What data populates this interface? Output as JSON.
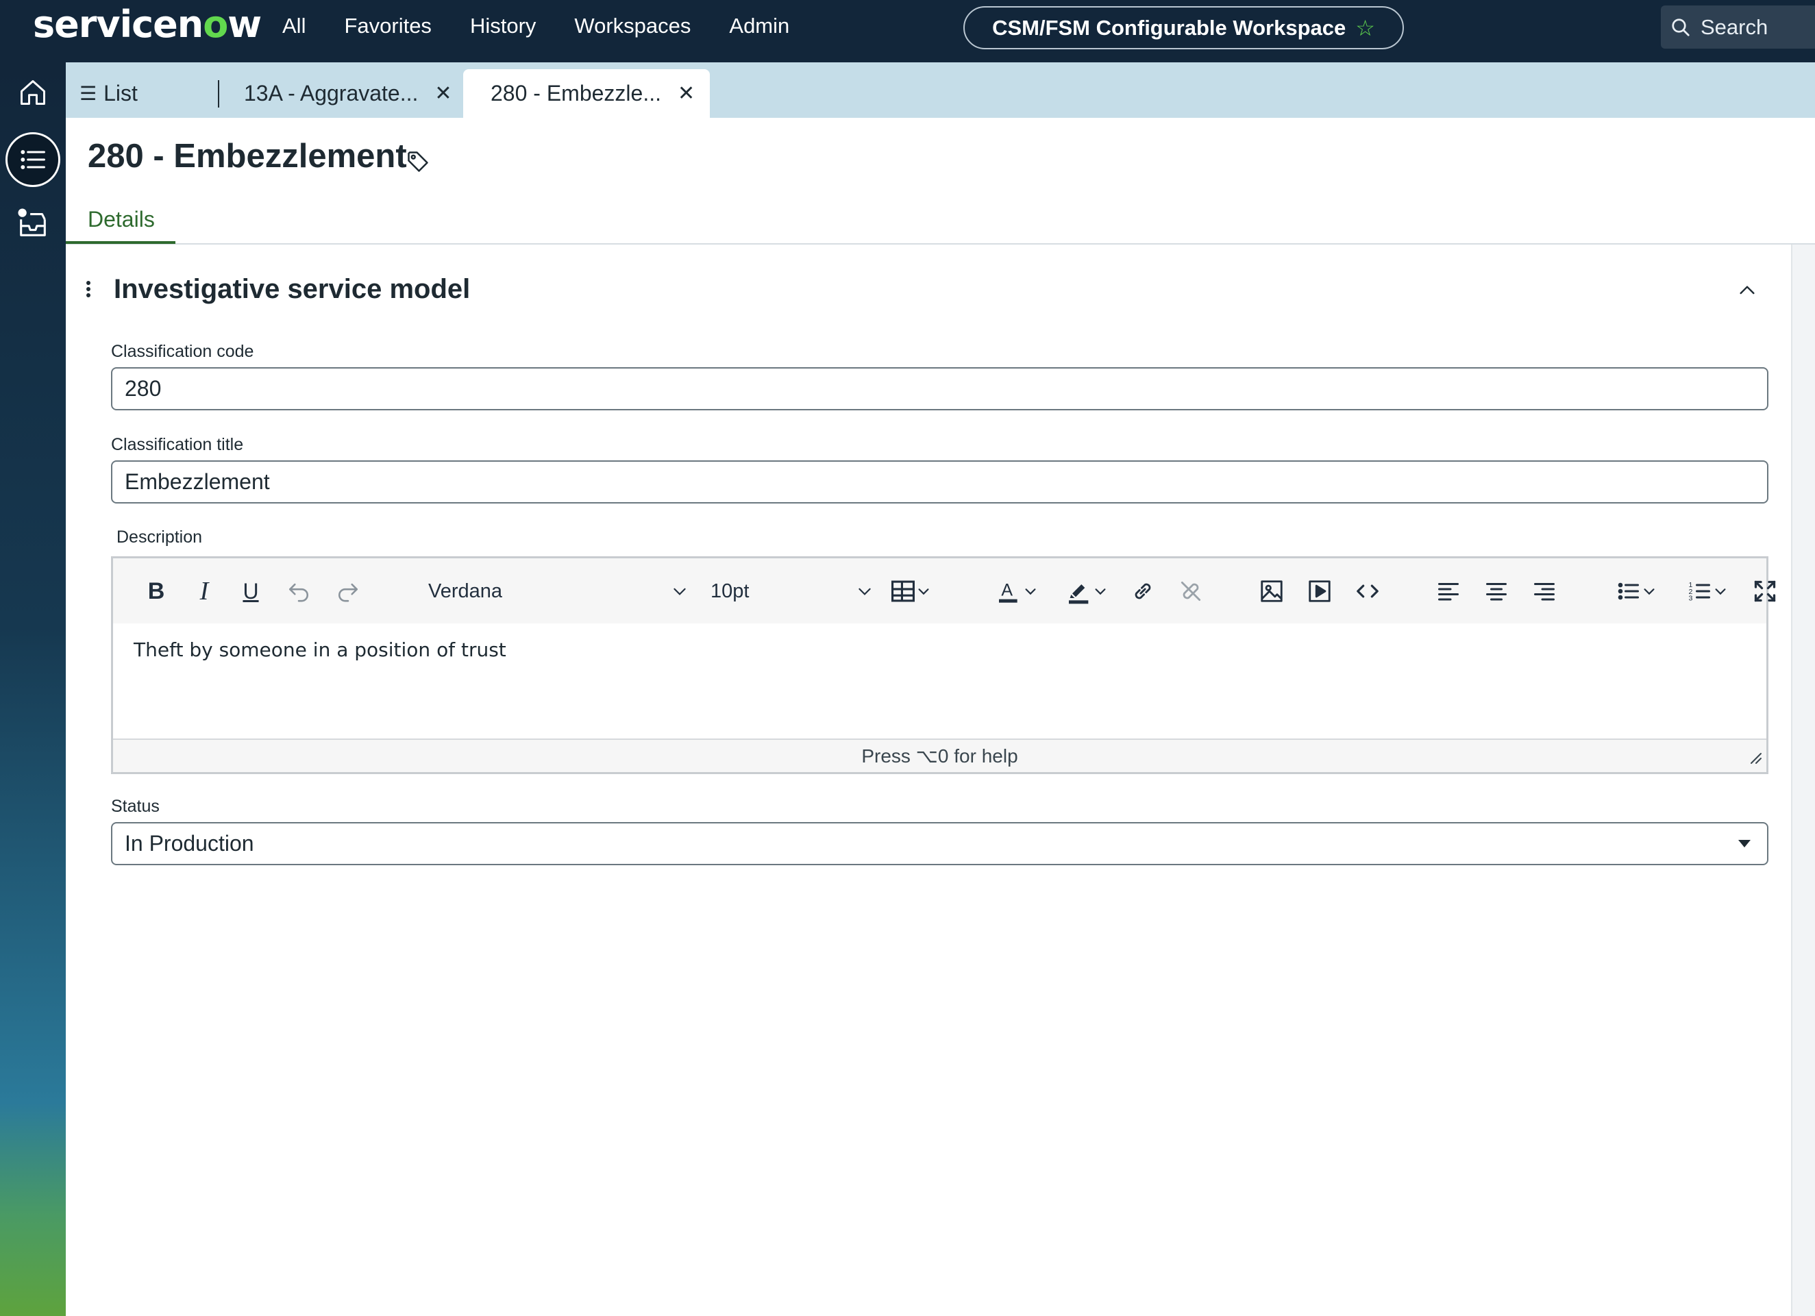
{
  "topnav": {
    "logo_text_pre": "servicen",
    "logo_text_accent": "o",
    "logo_text_post": "w",
    "items": [
      "All",
      "Favorites",
      "History",
      "Workspaces",
      "Admin"
    ],
    "workspace_label": "CSM/FSM Configurable Workspace",
    "search_label": "Search"
  },
  "rail": {
    "icons": [
      "home-icon",
      "list-icon",
      "inbox-icon"
    ]
  },
  "tabs": {
    "list_label": "List",
    "items": [
      {
        "label": "13A - Aggravate...",
        "active": false
      },
      {
        "label": "280 - Embezzle...",
        "active": true
      }
    ]
  },
  "record": {
    "title": "280 - Embezzlement",
    "subtabs": [
      "Details"
    ]
  },
  "section": {
    "title": "Investigative service model",
    "fields": {
      "classification_code": {
        "label": "Classification code",
        "value": "280"
      },
      "classification_title": {
        "label": "Classification title",
        "value": "Embezzlement"
      },
      "description": {
        "label": "Description",
        "font_family": "Verdana",
        "font_size": "10pt",
        "content": "Theft by someone in a position of trust",
        "status_hint": "Press ⌥0 for help"
      },
      "status": {
        "label": "Status",
        "value": "In Production"
      }
    }
  },
  "colors": {
    "nav_bg": "#12263a",
    "tab_strip_bg": "#c5dde8",
    "accent_green": "#62d84e",
    "details_green": "#2e6a2e"
  }
}
